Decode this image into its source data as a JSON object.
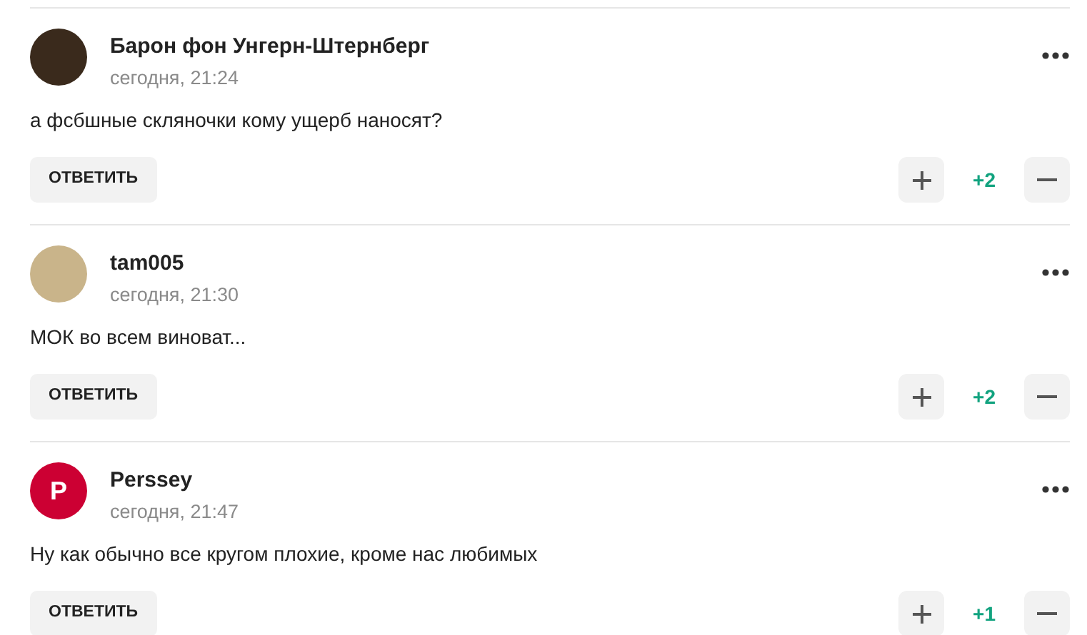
{
  "comments": [
    {
      "author": "Барон фон Унгерн-Штернберг",
      "time": "сегодня, 21:24",
      "text": "а фсбшные скляночки кому ущерб наносят?",
      "avatar": {
        "kind": "photo",
        "color": "#3a2a1c"
      },
      "reply": "ОТВЕТИТЬ",
      "score": "+2"
    },
    {
      "author": "tam005",
      "time": "сегодня, 21:30",
      "text": "МОК во всем виноват...",
      "avatar": {
        "kind": "photo",
        "color": "#c9b48a"
      },
      "reply": "ОТВЕТИТЬ",
      "score": "+2"
    },
    {
      "author": "Perssey",
      "time": "сегодня, 21:47",
      "text": "Ну как обычно все кругом плохие, кроме нас любимых",
      "avatar": {
        "kind": "letter",
        "letter": "P",
        "color": "#cc0033"
      },
      "reply": "ОТВЕТИТЬ",
      "score": "+1"
    }
  ]
}
